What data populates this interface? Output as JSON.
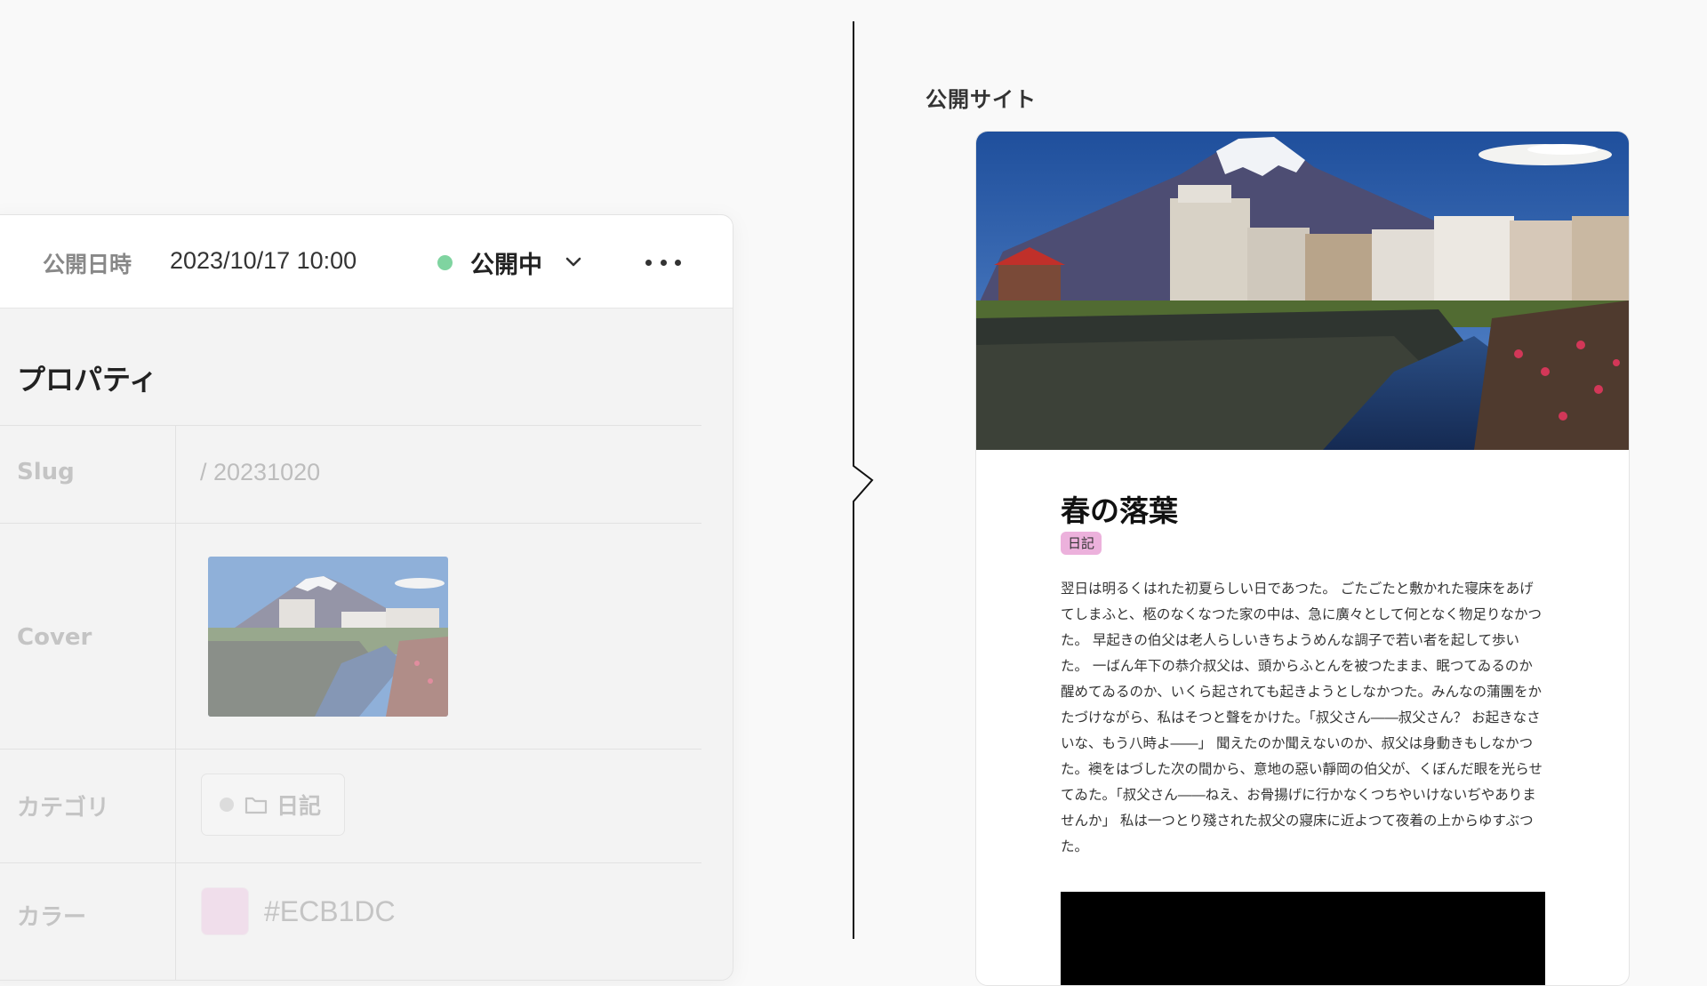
{
  "cms": {
    "publish_label": "公開日時",
    "publish_datetime": "2023/10/17 10:00",
    "status": {
      "text": "公開中",
      "dot_color": "#7fd4a0",
      "dropdown_icon": "chevron-down-icon"
    },
    "more_icon": "ellipsis-icon",
    "properties_title": "プロパティ",
    "slug": {
      "label": "Slug",
      "value": "/  20231020"
    },
    "cover": {
      "label": "Cover"
    },
    "category": {
      "label": "カテゴリ",
      "icon": "folder-icon",
      "value": "日記"
    },
    "color": {
      "label": "カラー",
      "value": "#ECB1DC",
      "swatch": "#ECB1DC"
    }
  },
  "site": {
    "label": "公開サイト",
    "article": {
      "title": "春の落葉",
      "tag": "日記",
      "tag_color": "#ECB1DC",
      "body": "翌日は明るくはれた初夏らしい日であつた。 ごたごたと敷かれた寝床をあげてしまふと、柩のなくなつた家の中は、急に廣々として何となく物足りなかつた。 早起きの伯父は老人らしいきちようめんな調子で若い者を起して歩いた。 一ばん年下の恭介叔父は、頭からふとんを被つたまま、眠つてゐるのか醒めてゐるのか、いくら起されても起きようとしなかつた。みんなの蒲團をかたづけながら、私はそつと聲をかけた。「叔父さん――叔父さん？ お起きなさいな、もう八時よ――」 聞えたのか聞えないのか、叔父は身動きもしなかつた。襖をはづした次の間から、意地の惡い靜岡の伯父が、くぼんだ眼を光らせてゐた。「叔父さん――ねえ、お骨揚げに行かなくつちやいけないぢやありませんか」 私は一つとり殘された叔父の寢床に近よつて夜着の上からゆすぶつた。"
    }
  }
}
